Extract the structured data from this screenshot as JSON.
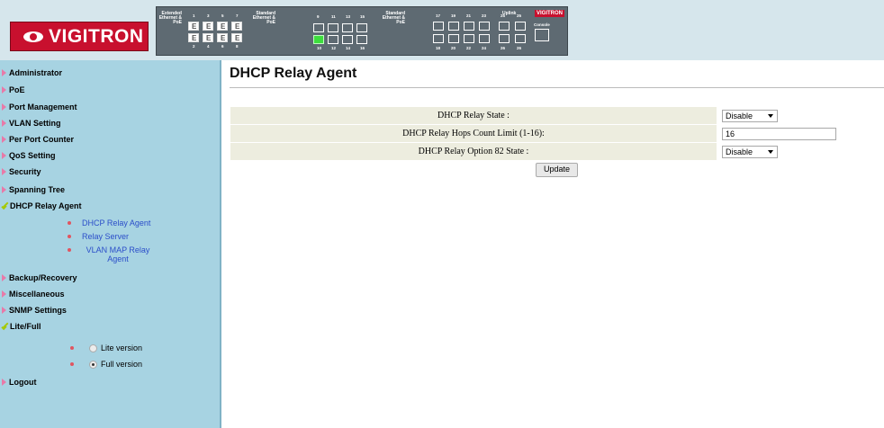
{
  "header": {
    "logo_text": "VIGITRON",
    "panel": {
      "group1_label": "Extended Ethernet & PoE",
      "group2_label": "Standard Ethernet & PoE",
      "group3_label": "Standard Ethernet & PoE",
      "uplink_label": "Uplink",
      "console_label": "Console",
      "brand_badge": "VIGITRON",
      "top_numbers_1": [
        "1",
        "3",
        "5",
        "7"
      ],
      "bottom_numbers_1": [
        "2",
        "4",
        "6",
        "8"
      ],
      "top_numbers_2": [
        "9",
        "11",
        "13",
        "15"
      ],
      "bottom_numbers_2": [
        "10",
        "12",
        "14",
        "16"
      ],
      "top_numbers_3": [
        "17",
        "19",
        "21",
        "23"
      ],
      "bottom_numbers_3": [
        "18",
        "20",
        "22",
        "24"
      ],
      "uplink_top": [
        "25",
        "25"
      ],
      "uplink_bottom": [
        "26",
        "26"
      ]
    }
  },
  "sidebar": {
    "items": [
      {
        "label": "Administrator",
        "state": "arrow"
      },
      {
        "label": "PoE",
        "state": "arrow"
      },
      {
        "label": "Port Management",
        "state": "arrow"
      },
      {
        "label": "VLAN Setting",
        "state": "arrow"
      },
      {
        "label": "Per Port Counter",
        "state": "arrow"
      },
      {
        "label": "QoS Setting",
        "state": "arrow"
      },
      {
        "label": "Security",
        "state": "arrow"
      },
      {
        "label": "Spanning Tree",
        "state": "arrow"
      },
      {
        "label": "DHCP Relay Agent",
        "state": "check"
      },
      {
        "label": "Backup/Recovery",
        "state": "arrow"
      },
      {
        "label": "Miscellaneous",
        "state": "arrow"
      },
      {
        "label": "SNMP Settings",
        "state": "arrow"
      },
      {
        "label": "Lite/Full",
        "state": "check"
      },
      {
        "label": "Logout",
        "state": "arrow"
      }
    ],
    "dhcp_sub": [
      "DHCP Relay Agent",
      "Relay Server",
      "VLAN MAP Relay Agent"
    ],
    "lite_full": {
      "lite": "Lite version",
      "full": "Full version",
      "selected": "full"
    }
  },
  "main": {
    "title": "DHCP Relay Agent",
    "rows": [
      {
        "label": "DHCP Relay State :",
        "type": "select",
        "value": "Disable"
      },
      {
        "label": "DHCP Relay Hops Count Limit (1-16):",
        "type": "text",
        "value": "16"
      },
      {
        "label": "DHCP Relay Option 82 State :",
        "type": "select",
        "value": "Disable"
      }
    ],
    "update_label": "Update"
  }
}
